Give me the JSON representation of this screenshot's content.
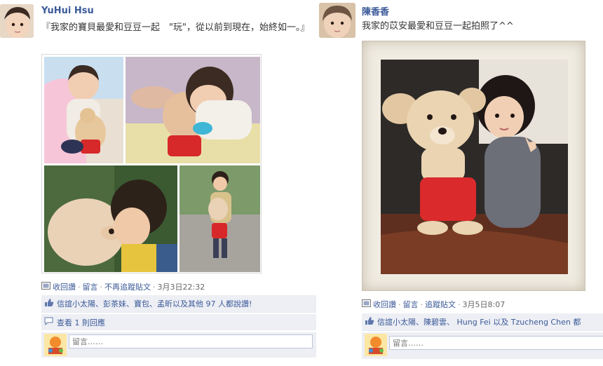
{
  "posts": [
    {
      "author": "YuHui Hsu",
      "message": "『我家的寶貝最愛和豆豆一起　\"玩\"，從以前到現在，始終如一。』",
      "actions": {
        "collect": "收回讚",
        "comment": "留言",
        "unfollow": "不再追蹤貼文",
        "timestamp": "3月3日22:32"
      },
      "likes_text": "信誼小太陽、彭茶妹、寶包、孟昕以及其他 97 人都說讚!",
      "view_comments": "查看 1 則回應",
      "comment_placeholder": "留言……"
    },
    {
      "author": "陳香香",
      "message": "我家的苡安最愛和豆豆一起拍照了^^",
      "actions": {
        "collect": "收回讚",
        "comment": "留言",
        "follow": "追蹤貼文",
        "timestamp": "3月5日8:07"
      },
      "likes_text": "信誼小太陽、陳碧雲、 Hung Fei 以及 Tzucheng Chen 都",
      "comment_placeholder": "留言……"
    }
  ],
  "separator": "·",
  "colors": {
    "link": "#3b5998",
    "panel": "#edeff4",
    "text": "#333333"
  }
}
